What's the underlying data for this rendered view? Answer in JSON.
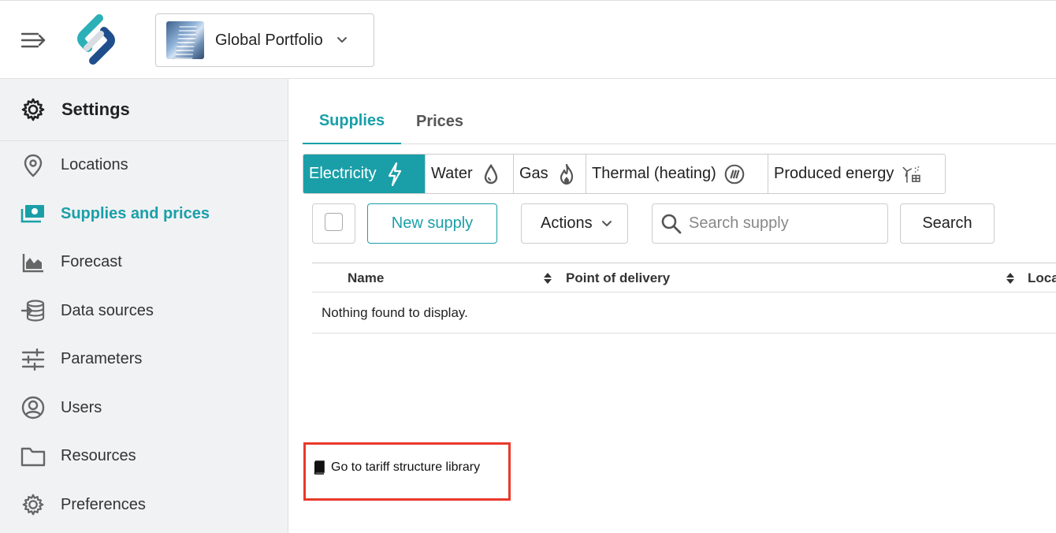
{
  "header": {
    "portfolio_name": "Global Portfolio",
    "menu_icon": "menu-expand-icon",
    "logo_icon": "app-logo"
  },
  "sidebar": {
    "title": "Settings",
    "items": [
      {
        "label": "Locations",
        "icon": "location-pin-icon",
        "active": false
      },
      {
        "label": "Supplies and prices",
        "icon": "money-icon",
        "active": true
      },
      {
        "label": "Forecast",
        "icon": "chart-icon",
        "active": false
      },
      {
        "label": "Data sources",
        "icon": "database-import-icon",
        "active": false
      },
      {
        "label": "Parameters",
        "icon": "sliders-icon",
        "active": false
      },
      {
        "label": "Users",
        "icon": "user-circle-icon",
        "active": false
      },
      {
        "label": "Resources",
        "icon": "folder-icon",
        "active": false
      },
      {
        "label": "Preferences",
        "icon": "gear-icon",
        "active": false
      }
    ]
  },
  "tabs": [
    {
      "label": "Supplies",
      "active": true
    },
    {
      "label": "Prices",
      "active": false
    }
  ],
  "energy_types": [
    {
      "label": "Electricity",
      "icon": "lightning-icon",
      "active": true
    },
    {
      "label": "Water",
      "icon": "water-drop-icon",
      "active": false
    },
    {
      "label": "Gas",
      "icon": "flame-icon",
      "active": false
    },
    {
      "label": "Thermal (heating)",
      "icon": "heating-icon",
      "active": false
    },
    {
      "label": "Produced energy",
      "icon": "wind-solar-icon",
      "active": false
    }
  ],
  "toolbar": {
    "new_supply": "New supply",
    "actions": "Actions",
    "search_placeholder": "Search supply",
    "search_button": "Search"
  },
  "table": {
    "columns": [
      "Name",
      "Point of delivery",
      "Loca"
    ],
    "empty_message": "Nothing found to display."
  },
  "footer_link": "Go to tariff structure library",
  "colors": {
    "accent": "#1a9fa8",
    "highlight": "#e8392a",
    "sidebar_bg": "#f1f2f4"
  }
}
